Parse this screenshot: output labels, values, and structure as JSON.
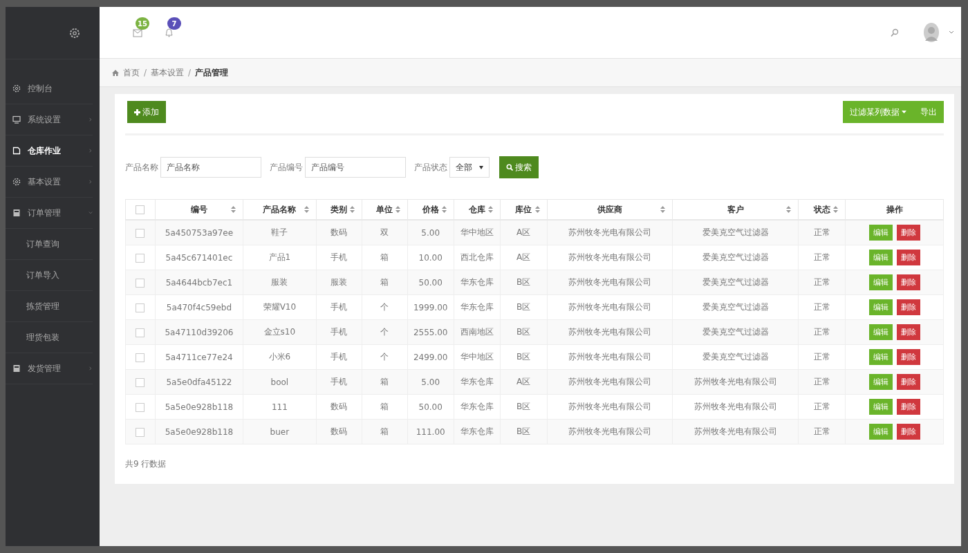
{
  "header": {
    "badges": [
      {
        "kind": "mail",
        "count": "15",
        "color": "#7cb342"
      },
      {
        "kind": "bell",
        "count": "7",
        "color": "#5a4fb8"
      }
    ]
  },
  "sidebar": {
    "items": [
      {
        "kind": "gear",
        "label": "控制台",
        "selected": false
      },
      {
        "kind": "monitor",
        "label": "系统设置",
        "selected": false,
        "expanded": false
      },
      {
        "kind": "doc",
        "label": "仓库作业",
        "selected": true,
        "expanded": false
      },
      {
        "kind": "gear",
        "label": "基本设置",
        "selected": false,
        "expanded": false
      },
      {
        "kind": "file",
        "label": "订单管理",
        "selected": false,
        "expanded": true,
        "children": [
          {
            "label": "订单查询"
          },
          {
            "label": "订单导入"
          },
          {
            "label": "拣货管理"
          },
          {
            "label": "理货包装"
          }
        ]
      },
      {
        "kind": "file",
        "label": "发货管理",
        "selected": false,
        "expanded": false
      }
    ]
  },
  "breadcrumb": [
    {
      "label": "首页"
    },
    {
      "separator": "/",
      "label": "基本设置"
    },
    {
      "separator": "/",
      "label": "产品管理"
    }
  ],
  "toolbar": {
    "add": "添加",
    "filter": "过滤某列数据",
    "export": "导出"
  },
  "search": {
    "fields": [
      {
        "kind": "text",
        "label": "产品名称",
        "placeholder": "产品名称"
      },
      {
        "kind": "text",
        "label": "产品编号",
        "placeholder": "产品编号"
      },
      {
        "kind": "select",
        "label": "产品状态",
        "value": "全部"
      }
    ],
    "button": "搜索"
  },
  "table": {
    "all_checked": false,
    "columns": [
      {
        "label": "编号",
        "sortable": true
      },
      {
        "label": "产品名称",
        "sortable": true
      },
      {
        "label": "类别",
        "sortable": true
      },
      {
        "label": "单位",
        "sortable": true
      },
      {
        "label": "价格",
        "sortable": true
      },
      {
        "label": "仓库",
        "sortable": true
      },
      {
        "label": "库位",
        "sortable": true
      },
      {
        "label": "供应商",
        "sortable": true
      },
      {
        "label": "客户",
        "sortable": true
      },
      {
        "label": "状态",
        "sortable": true
      },
      {
        "label": "操作",
        "sortable": false
      }
    ],
    "rows": [
      {
        "checked": false,
        "cells": [
          "5a450753a97ee",
          "鞋子",
          "数码",
          "双",
          "5.00",
          "华中地区",
          "A区",
          "苏州牧冬光电有限公司",
          "爱美克空气过滤器",
          "正常"
        ],
        "actions": [
          {
            "kind": "edit",
            "label": "编辑"
          },
          {
            "kind": "delete",
            "label": "删除"
          }
        ]
      },
      {
        "checked": false,
        "cells": [
          "5a45c671401ec",
          "产品1",
          "手机",
          "箱",
          "10.00",
          "西北仓库",
          "A区",
          "苏州牧冬光电有限公司",
          "爱美克空气过滤器",
          "正常"
        ],
        "actions": [
          {
            "kind": "edit",
            "label": "编辑"
          },
          {
            "kind": "delete",
            "label": "删除"
          }
        ]
      },
      {
        "checked": false,
        "cells": [
          "5a4644bcb7ec1",
          "服装",
          "服装",
          "箱",
          "50.00",
          "华东仓库",
          "B区",
          "苏州牧冬光电有限公司",
          "爱美克空气过滤器",
          "正常"
        ],
        "actions": [
          {
            "kind": "edit",
            "label": "编辑"
          },
          {
            "kind": "delete",
            "label": "删除"
          }
        ]
      },
      {
        "checked": false,
        "cells": [
          "5a470f4c59ebd",
          "荣耀V10",
          "手机",
          "个",
          "1999.00",
          "华东仓库",
          "B区",
          "苏州牧冬光电有限公司",
          "爱美克空气过滤器",
          "正常"
        ],
        "actions": [
          {
            "kind": "edit",
            "label": "编辑"
          },
          {
            "kind": "delete",
            "label": "删除"
          }
        ]
      },
      {
        "checked": false,
        "cells": [
          "5a47110d39206",
          "金立s10",
          "手机",
          "个",
          "2555.00",
          "西南地区",
          "B区",
          "苏州牧冬光电有限公司",
          "爱美克空气过滤器",
          "正常"
        ],
        "actions": [
          {
            "kind": "edit",
            "label": "编辑"
          },
          {
            "kind": "delete",
            "label": "删除"
          }
        ]
      },
      {
        "checked": false,
        "cells": [
          "5a4711ce77e24",
          "小米6",
          "手机",
          "个",
          "2499.00",
          "华中地区",
          "B区",
          "苏州牧冬光电有限公司",
          "爱美克空气过滤器",
          "正常"
        ],
        "actions": [
          {
            "kind": "edit",
            "label": "编辑"
          },
          {
            "kind": "delete",
            "label": "删除"
          }
        ]
      },
      {
        "checked": false,
        "cells": [
          "5a5e0dfa45122",
          "bool",
          "手机",
          "箱",
          "5.00",
          "华东仓库",
          "A区",
          "苏州牧冬光电有限公司",
          "苏州牧冬光电有限公司",
          "正常"
        ],
        "actions": [
          {
            "kind": "edit",
            "label": "编辑"
          },
          {
            "kind": "delete",
            "label": "删除"
          }
        ]
      },
      {
        "checked": false,
        "cells": [
          "5a5e0e928b118",
          "111",
          "数码",
          "箱",
          "50.00",
          "华东仓库",
          "B区",
          "苏州牧冬光电有限公司",
          "苏州牧冬光电有限公司",
          "正常"
        ],
        "actions": [
          {
            "kind": "edit",
            "label": "编辑"
          },
          {
            "kind": "delete",
            "label": "删除"
          }
        ]
      },
      {
        "checked": false,
        "cells": [
          "5a5e0e928b118",
          "buer",
          "数码",
          "箱",
          "111.00",
          "华东仓库",
          "B区",
          "苏州牧冬光电有限公司",
          "苏州牧冬光电有限公司",
          "正常"
        ],
        "actions": [
          {
            "kind": "edit",
            "label": "编辑"
          },
          {
            "kind": "delete",
            "label": "删除"
          }
        ]
      }
    ]
  },
  "footer": "共9 行数据"
}
